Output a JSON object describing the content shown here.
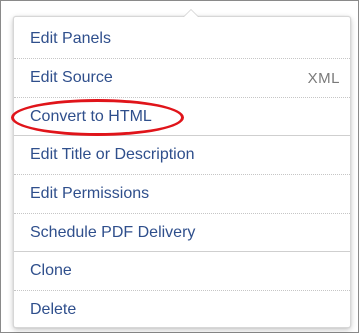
{
  "menu": {
    "items": [
      {
        "label": "Edit Panels",
        "shortcut": ""
      },
      {
        "label": "Edit Source",
        "shortcut": "XML"
      },
      {
        "label": "Convert to HTML",
        "shortcut": ""
      },
      {
        "label": "Edit Title or Description",
        "shortcut": ""
      },
      {
        "label": "Edit Permissions",
        "shortcut": ""
      },
      {
        "label": "Schedule PDF Delivery",
        "shortcut": ""
      },
      {
        "label": "Clone",
        "shortcut": ""
      },
      {
        "label": "Delete",
        "shortcut": ""
      }
    ]
  },
  "colors": {
    "link_text": "#2f4f8c",
    "annotation_oval": "#e0141a"
  }
}
